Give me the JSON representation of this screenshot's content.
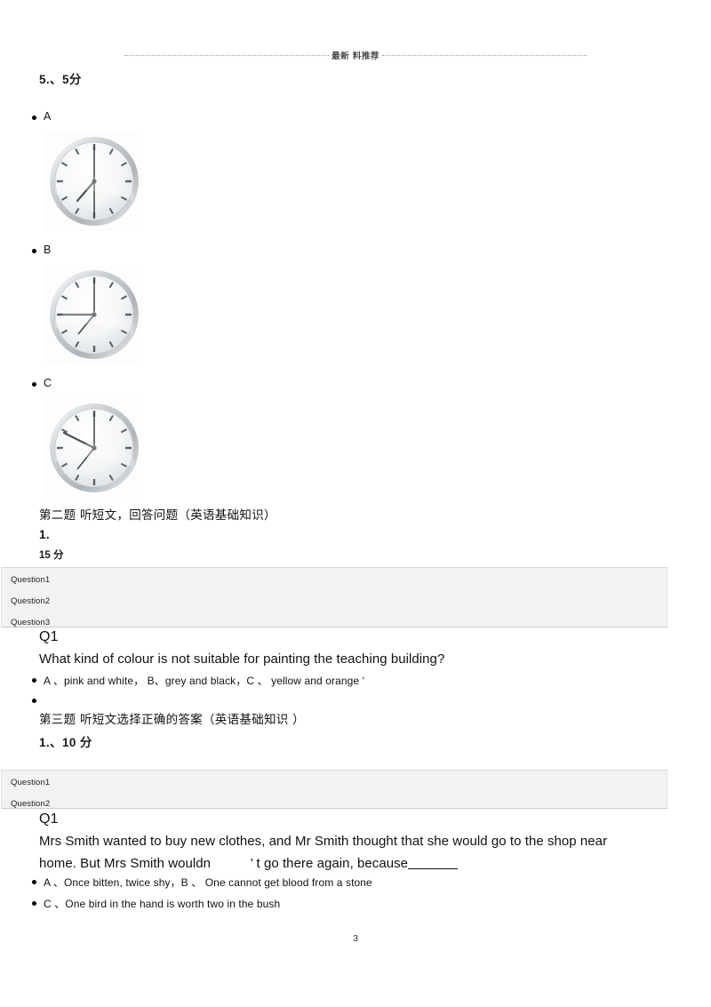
{
  "header": {
    "text": "最新 料推荐"
  },
  "section_one": {
    "item_number": "5.、5分",
    "options": [
      {
        "label": "A",
        "image": "analog-clock-a"
      },
      {
        "label": "B",
        "image": "analog-clock-b"
      },
      {
        "label": "C",
        "image": "analog-clock-c"
      }
    ]
  },
  "section_two": {
    "heading": "第二题 听短文，回答问题（英语基础知识）",
    "item_number": "1.",
    "points": "15 分",
    "panel_items": [
      "Question1",
      "Question2",
      "Question3"
    ],
    "question_tag": "Q1",
    "question_text": "What kind of colour is not suitable for painting the teaching building?",
    "answer_option": "A 、pink and white， B、grey and black，C 、 yellow and orange  ‘"
  },
  "section_three": {
    "empty_bullet": "",
    "heading": "第三题 听短文选择正确的答案（英语基础知识 ）",
    "item_number": "1.、10 分",
    "panel_items": [
      "Question1",
      "Question2"
    ],
    "question_tag": "Q1",
    "question_line1": "Mrs Smith wanted to buy new clothes, and Mr Smith thought that she would go to the shop near",
    "question_line2_before": "home. But Mrs Smith wouldn",
    "question_line2_after": "’ t go there again, because",
    "answer_options": [
      "A 、Once  bitten,  twice  shy，B 、 One cannot  get blood  from  a stone",
      "C 、One  bird in the hand   is worth   two in the bush"
    ]
  },
  "footer": {
    "page_number": "3"
  },
  "colors": {
    "panel_bg": "#f2f2f2",
    "panel_border": "#d8d8d8",
    "text": "#111111",
    "header_rule": "#8c8c8c"
  }
}
